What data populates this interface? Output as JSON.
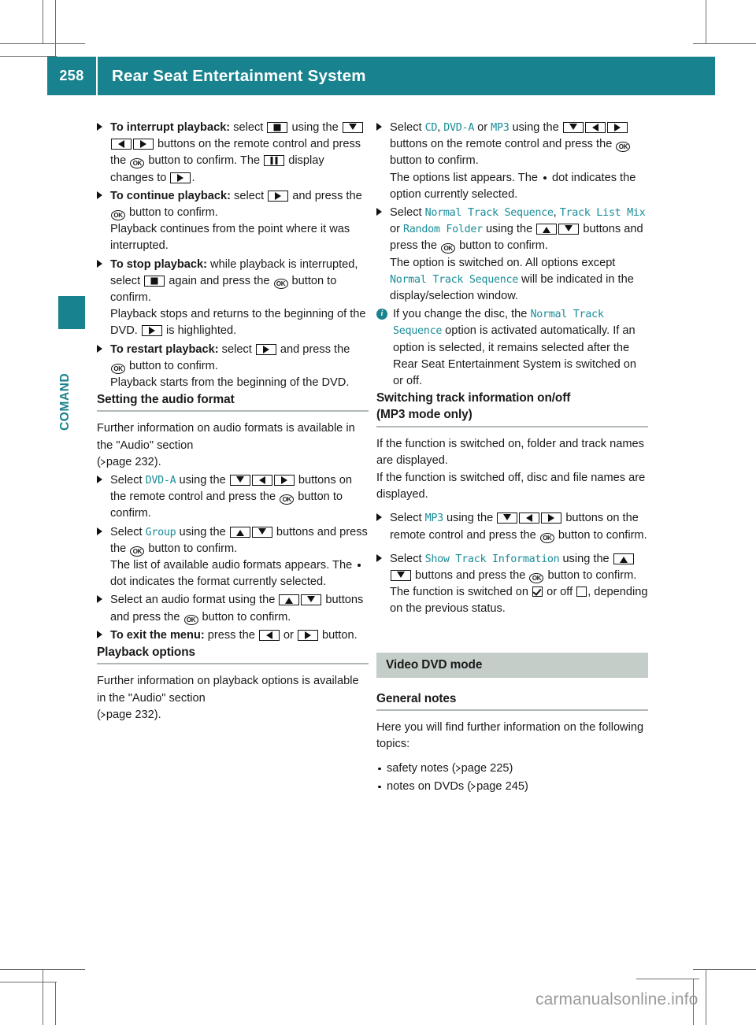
{
  "header": {
    "page_number": "258",
    "title": "Rear Seat Entertainment System",
    "bar_color": "#18838e"
  },
  "sidebar": {
    "chapter_label": "COMAND",
    "tab_color": "#18838e"
  },
  "colors": {
    "teal": "#18838e",
    "ui_text_teal": "#1a8d99",
    "band_gray": "#c5cdc9",
    "rule_gray": "#b0b8b5"
  },
  "left_column": {
    "step_interrupt": {
      "lead": "To interrupt playback:",
      "t1": " select ",
      "t2": " using the ",
      "t3": " buttons on the remote control and press the ",
      "t4": " button to confirm. The ",
      "t5": " display changes to ",
      "t6": "."
    },
    "step_continue": {
      "lead": "To continue playback:",
      "t1": " select ",
      "t2": " and press the ",
      "t3": " button to confirm.",
      "t4": "Playback continues from the point where it was interrupted."
    },
    "step_stop": {
      "lead": "To stop playback:",
      "t1": " while playback is interrupted, select ",
      "t2": " again and press the ",
      "t3": " button to confirm.",
      "t4": "Playback stops and returns to the beginning of the DVD. ",
      "t5": " is highlighted."
    },
    "step_restart": {
      "lead": "To restart playback:",
      "t1": " select ",
      "t2": " and press the ",
      "t3": " button to confirm.",
      "t4": "Playback starts from the beginning of the DVD."
    },
    "heading_audio_format": "Setting the audio format",
    "audio_intro_1": "Further information on audio formats is available in the \"Audio\" section",
    "audio_intro_2": "page 232).",
    "step_select_dvda": {
      "t1": "Select ",
      "ui": "DVD-A",
      "t2": " using the ",
      "t3": " buttons on the remote control and press the ",
      "t4": " button to confirm."
    },
    "step_select_group": {
      "t1": "Select ",
      "ui": "Group",
      "t2": " using the ",
      "t3": " buttons and press the ",
      "t4": " button to confirm.",
      "t5": "The list of available audio formats appears. The ",
      "t6": " dot indicates the format currently selected."
    },
    "step_select_format": {
      "t1": "Select an audio format using the ",
      "t2": " buttons and press the ",
      "t3": " button to confirm."
    },
    "step_exit_menu": {
      "lead": "To exit the menu:",
      "t1": " press the ",
      "t2": " or ",
      "t3": " button."
    },
    "heading_playback_options": "Playback options",
    "playback_intro_1": "Further information on playback options is available in the \"Audio\" section",
    "playback_intro_2": "page 232)."
  },
  "right_column": {
    "step_select_disc": {
      "t1": "Select ",
      "ui1": "CD",
      "t2": ", ",
      "ui2": "DVD-A",
      "t3": " or ",
      "ui3": "MP3",
      "t4": " using the ",
      "t5": " buttons on the remote control and press the ",
      "t6": " button to confirm.",
      "t7": "The options list appears. The ",
      "t8": " dot indicates the option currently selected."
    },
    "step_select_sequence": {
      "t1": "Select ",
      "ui1": "Normal Track Sequence",
      "t2": ", ",
      "ui2": "Track List Mix",
      "t3": " or ",
      "ui3": "Random Folder",
      "t4": " using the ",
      "t5": " buttons and press the ",
      "t6": " button to confirm.",
      "t7": "The option is switched on. All options except ",
      "ui4": "Normal Track Sequence",
      "t8": " will be indicated in the display/selection window."
    },
    "note_disc_change": {
      "t1": "If you change the disc, the ",
      "ui1": "Normal Track Sequence",
      "t2": " option is activated automatically. If an option is selected, it remains selected after the Rear Seat Entertainment System is switched on or off."
    },
    "heading_track_info_1": "Switching track information on/off",
    "heading_track_info_2": "(MP3 mode only)",
    "track_info_p1": "If the function is switched on, folder and track names are displayed.",
    "track_info_p2": "If the function is switched off, disc and file names are displayed.",
    "step_select_mp3": {
      "t1": "Select ",
      "ui": "MP3",
      "t2": " using the ",
      "t3": " buttons on the remote control and press the ",
      "t4": " button to confirm."
    },
    "step_show_track_info": {
      "t1": "Select ",
      "ui": "Show Track Information",
      "t2": " using the ",
      "t3": " buttons and press the ",
      "t4": " button to confirm.",
      "t5": "The function is switched on ",
      "t6": " or off ",
      "t7": ", depending on the previous status."
    },
    "chapter_band": "Video DVD mode",
    "heading_general_notes": "General notes",
    "general_notes_intro": "Here you will find further information on the following topics:",
    "bullets": [
      {
        "text": "safety notes (",
        "pageref": "page 225)"
      },
      {
        "text": "notes on DVDs (",
        "pageref": "page 245)"
      }
    ]
  },
  "watermark": "carmanualsonline.info"
}
